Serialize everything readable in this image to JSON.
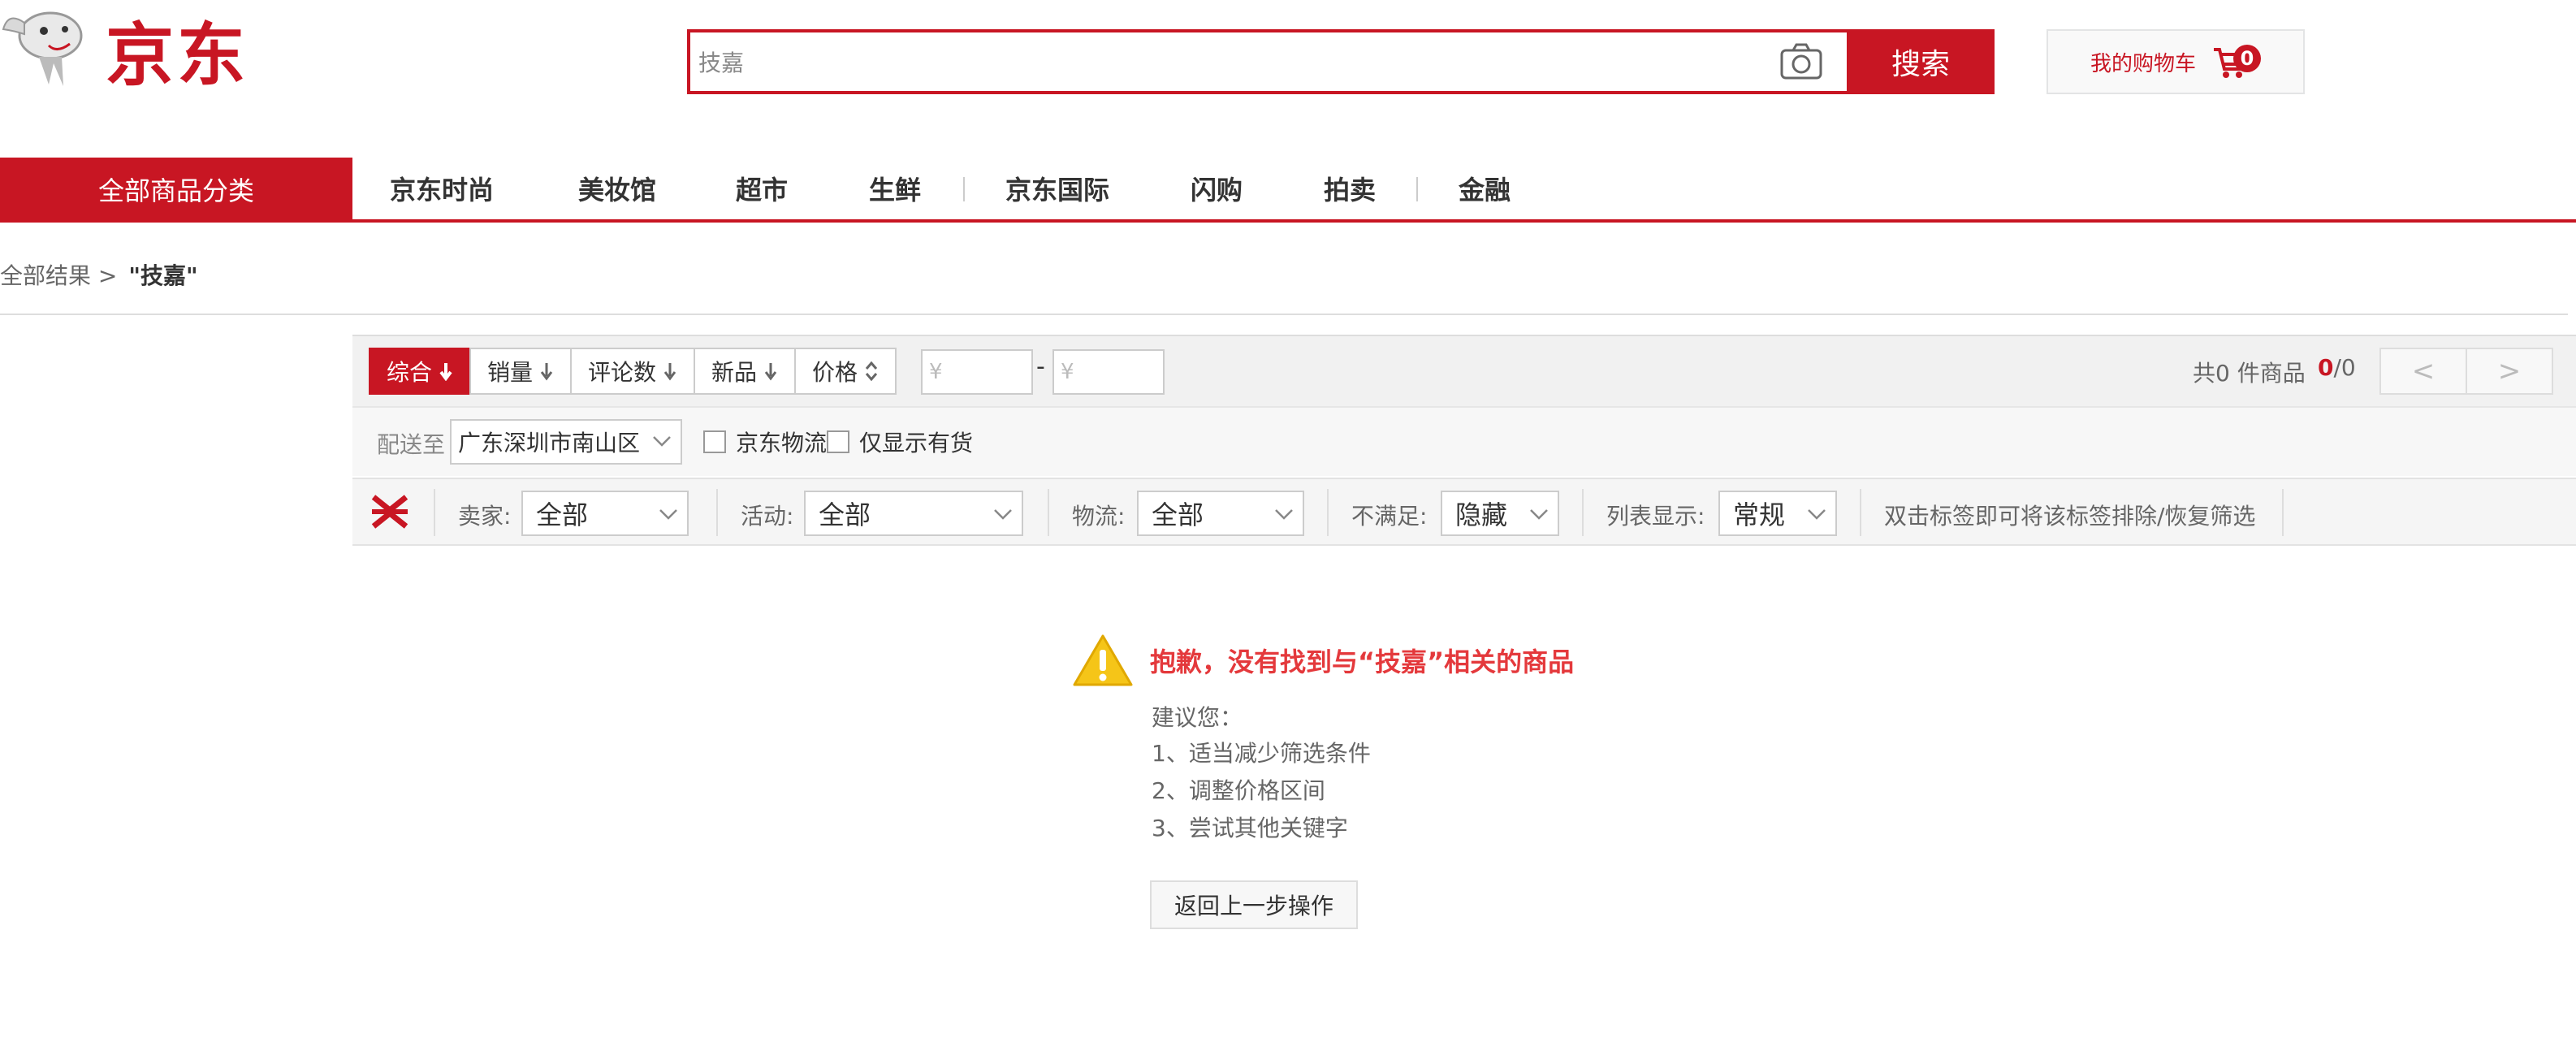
{
  "header": {
    "logo_text": "京东",
    "search_value": "技嘉",
    "search_button_label": "搜索",
    "cart_label": "我的购物车",
    "cart_count": "0"
  },
  "nav": {
    "all_categories": "全部商品分类",
    "items": [
      "京东时尚",
      "美妆馆",
      "超市",
      "生鲜",
      "京东国际",
      "闪购",
      "拍卖",
      "金融"
    ]
  },
  "breadcrumb": {
    "root": "全部结果 >",
    "current": "\"技嘉\""
  },
  "sort_bar": {
    "sorts": [
      "综合",
      "销量",
      "评论数",
      "新品",
      "价格"
    ],
    "price_min_placeholder": "¥",
    "price_max_placeholder": "¥",
    "price_dash": "-",
    "result_count": "共0 件商品",
    "page_current": "0",
    "page_total": "/0",
    "prev": "<",
    "next": ">"
  },
  "delivery_bar": {
    "ship_label": "配送至",
    "region": "广东深圳市南山区",
    "checkbox_jd_logistics": "京东物流",
    "checkbox_in_stock": "仅显示有货"
  },
  "filter_bar": {
    "seller_label": "卖家:",
    "seller_value": "全部",
    "activity_label": "活动:",
    "activity_value": "全部",
    "logistics_label": "物流:",
    "logistics_value": "全部",
    "unsatisfied_label": "不满足:",
    "unsatisfied_value": "隐藏",
    "list_display_label": "列表显示:",
    "list_display_value": "常规",
    "hint": "双击标签即可将该标签排除/恢复筛选"
  },
  "empty_state": {
    "title_prefix": "抱歉，没有找到与“",
    "title_keyword": "技嘉",
    "title_suffix": "”相关的商品",
    "suggest_heading": "建议您：",
    "suggestions": [
      "1、适当减少筛选条件",
      "2、调整价格区间",
      "3、尝试其他关键字"
    ],
    "back_button": "返回上一步操作"
  },
  "colors": {
    "brand_red": "#c81623",
    "warning_yellow": "#f5c518"
  }
}
